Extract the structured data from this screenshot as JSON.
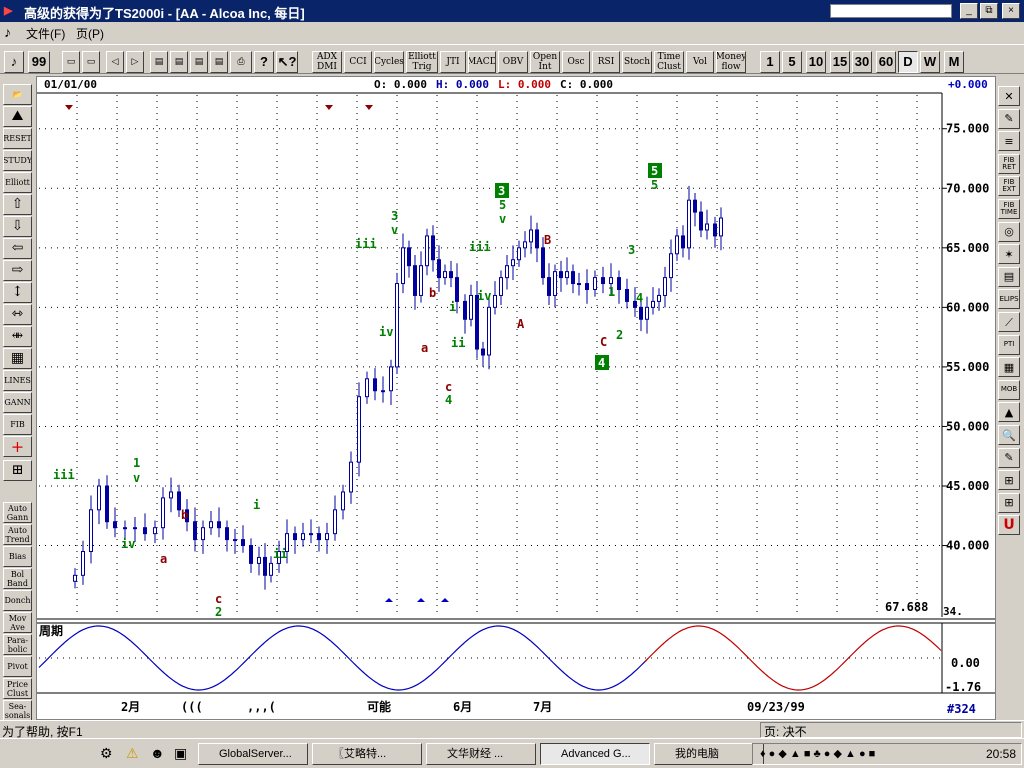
{
  "window": {
    "title": "高级的获得为了TS2000i - [AA - Alcoa Inc, 每日]",
    "min": "_",
    "max": "□",
    "close": "×",
    "restore": "⧉",
    "close2": "×"
  },
  "menu": {
    "file": "文件(F)",
    "page": "页(P)"
  },
  "toolbar": {
    "indicators": [
      "ADX DMI",
      "CCI",
      "Cycles",
      "Elliott Trig",
      "JTI",
      "MACD",
      "OBV",
      "Open Int",
      "Osc",
      "RSI",
      "Stoch",
      "Time Clust",
      "Vol",
      "Money flow"
    ],
    "periods": [
      "1",
      "5",
      "10",
      "15",
      "30",
      "60",
      "D",
      "W",
      "M"
    ],
    "selected_period": "D"
  },
  "leftbar": [
    "RESET",
    "STUDY",
    "Elliott",
    "↑",
    "↓",
    "←",
    "→",
    "LINES",
    "GANN",
    "FIB",
    "+",
    "Auto Gann",
    "Auto Trend",
    "Bias",
    "Bol Band",
    "Donch",
    "Mov Ave",
    "Para-bolic",
    "Pivot",
    "Price Clust",
    "Sea-sonals"
  ],
  "rightbar": [
    "FIB RET",
    "FIB EXT",
    "FIB TIME",
    "ELIPS",
    "PTI",
    "MOB",
    "U"
  ],
  "infobar": {
    "date": "01/01/00",
    "o": "O: 0.000",
    "h": "H: 0.000",
    "l": "L: 0.000",
    "c": "C: 0.000",
    "change": "+0.000"
  },
  "oscillator": {
    "label": "周期",
    "current": "-1.76",
    "zero": "0.00"
  },
  "price_readout": "67.688",
  "corner_box": "34.",
  "bar_count": "#324",
  "xaxis": [
    "2月",
    "(((",
    ",,,(",
    "可能",
    "6月",
    "7月",
    "09/23/99"
  ],
  "status": {
    "help": "为了帮助, 按F1",
    "page": "页: 决不"
  },
  "taskbar": {
    "items": [
      "GlobalServer...",
      "〖艾略特...",
      "文华财经 ...",
      "Advanced G...",
      "我的电脑"
    ],
    "clock": "20:58"
  },
  "colors": {
    "up": "#0000a0",
    "green": "#008000",
    "darkred": "#8b0000",
    "sine_blue": "#0000c0",
    "sine_red": "#c00000"
  },
  "chart_data": {
    "type": "candlestick",
    "ylim": [
      34,
      78
    ],
    "yticks": [
      "75.000",
      "70.000",
      "65.000",
      "60.000",
      "55.000",
      "50.000",
      "45.000",
      "40.000"
    ],
    "wave_labels": [
      "iii",
      "1",
      "v",
      "iv",
      "b",
      "a",
      "c",
      "2",
      "i",
      "ii",
      "3",
      "v",
      "iii",
      "iv",
      "b",
      "a",
      "i",
      "ii",
      "c",
      "4",
      "3",
      "5",
      "v",
      "iii",
      "iv",
      "B",
      "A",
      "C",
      "4",
      "1",
      "2",
      "3",
      "4",
      "5",
      "5"
    ]
  }
}
